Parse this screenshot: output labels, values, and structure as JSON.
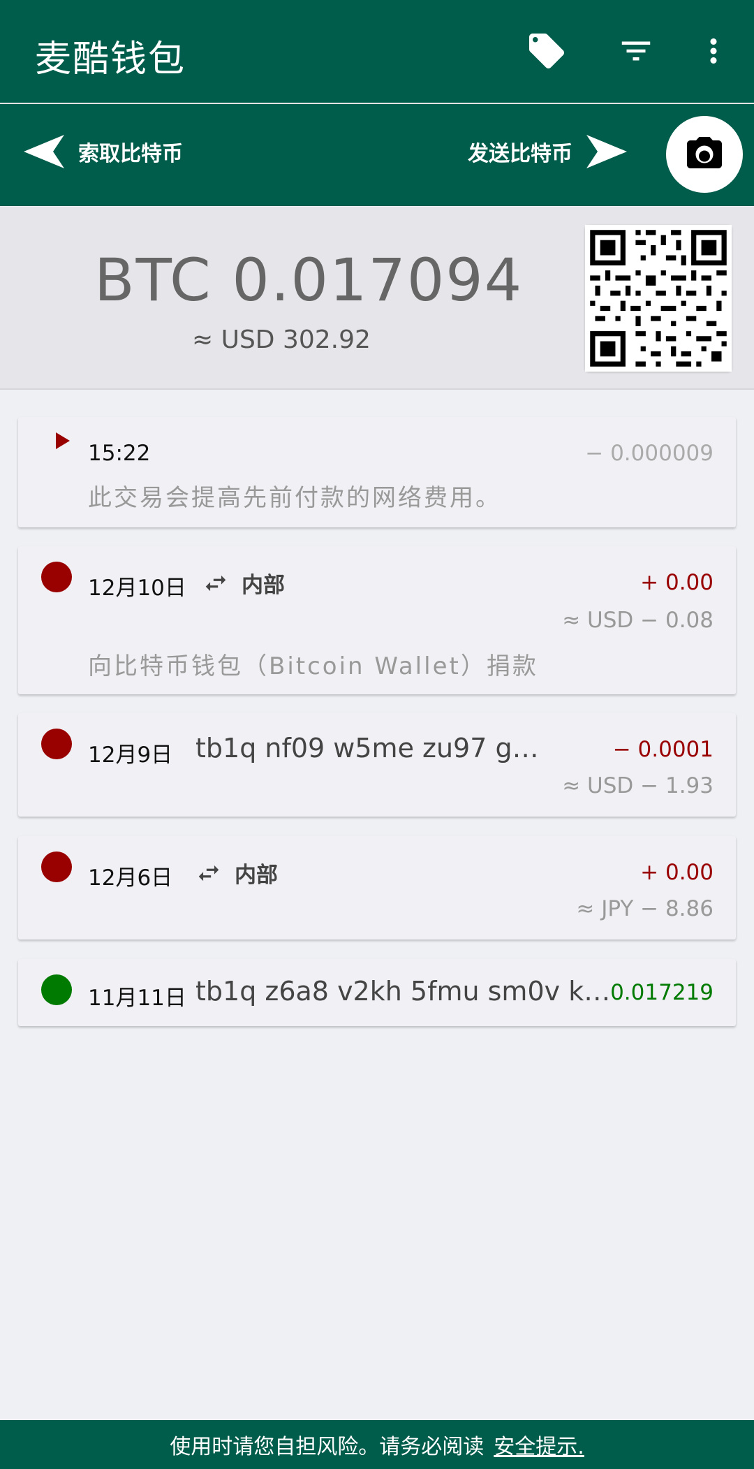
{
  "app": {
    "title": "麦酷钱包"
  },
  "toolbar": {
    "tag_icon": "tag-icon",
    "filter_icon": "filter-icon",
    "more_icon": "more-vert-icon"
  },
  "actions": {
    "request_label": "索取比特币",
    "send_label": "发送比特币"
  },
  "balance": {
    "btc": "BTC 0.017094",
    "fiat": "≈ USD 302.92"
  },
  "transactions": [
    {
      "date": "15:22",
      "amount": "− 0.000009",
      "memo": "此交易会提高先前付款的网络费用。",
      "status": "pending"
    },
    {
      "date": "12月10日",
      "label": "内部",
      "amount": "+ 0.00",
      "fiat": "≈ USD  − 0.08",
      "memo": "向比特币钱包（Bitcoin Wallet）捐款",
      "status": "red"
    },
    {
      "date": "12月9日",
      "address": "tb1q nf09 w5me zu97 g…",
      "amount": "− 0.0001",
      "fiat": "≈ USD  − 1.93",
      "status": "red"
    },
    {
      "date": "12月6日",
      "label": "内部",
      "amount": "+ 0.00",
      "fiat": "≈ JPY  − 8.86",
      "status": "red"
    },
    {
      "date": "11月11日",
      "address": "tb1q z6a8 v2kh 5fmu sm0v k…",
      "amount": "0.017219",
      "status": "green"
    }
  ],
  "footer": {
    "text": "使用时请您自担风险。请务必阅读",
    "link": "安全提示."
  },
  "colors": {
    "primary": "#005c4b",
    "negative": "#990000",
    "positive": "#007a00"
  }
}
